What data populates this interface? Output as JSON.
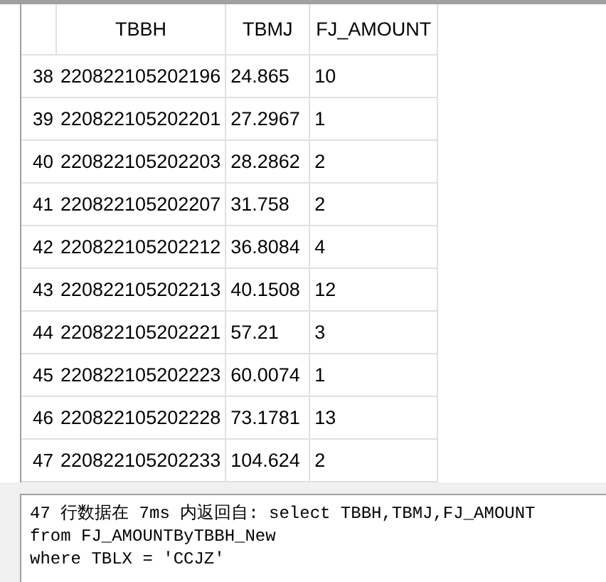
{
  "table": {
    "columns": [
      "TBBH",
      "TBMJ",
      "FJ_AMOUNT"
    ],
    "rows": [
      {
        "row_number": "38",
        "cells": [
          "220822105202196",
          "24.865",
          "10"
        ]
      },
      {
        "row_number": "39",
        "cells": [
          "220822105202201",
          "27.2967",
          "1"
        ]
      },
      {
        "row_number": "40",
        "cells": [
          "220822105202203",
          "28.2862",
          "2"
        ]
      },
      {
        "row_number": "41",
        "cells": [
          "220822105202207",
          "31.758",
          "2"
        ]
      },
      {
        "row_number": "42",
        "cells": [
          "220822105202212",
          "36.8084",
          "4"
        ]
      },
      {
        "row_number": "43",
        "cells": [
          "220822105202213",
          "40.1508",
          "12"
        ]
      },
      {
        "row_number": "44",
        "cells": [
          "220822105202221",
          "57.21",
          "3"
        ]
      },
      {
        "row_number": "45",
        "cells": [
          "220822105202223",
          "60.0074",
          "1"
        ]
      },
      {
        "row_number": "46",
        "cells": [
          "220822105202228",
          "73.1781",
          "13"
        ]
      },
      {
        "row_number": "47",
        "cells": [
          "220822105202233",
          "104.624",
          "2"
        ]
      }
    ]
  },
  "message": "47 行数据在 7ms 内返回自: select TBBH,TBMJ,FJ_AMOUNT\nfrom FJ_AMOUNTByTBBH_New\nwhere TBLX = 'CCJZ'"
}
